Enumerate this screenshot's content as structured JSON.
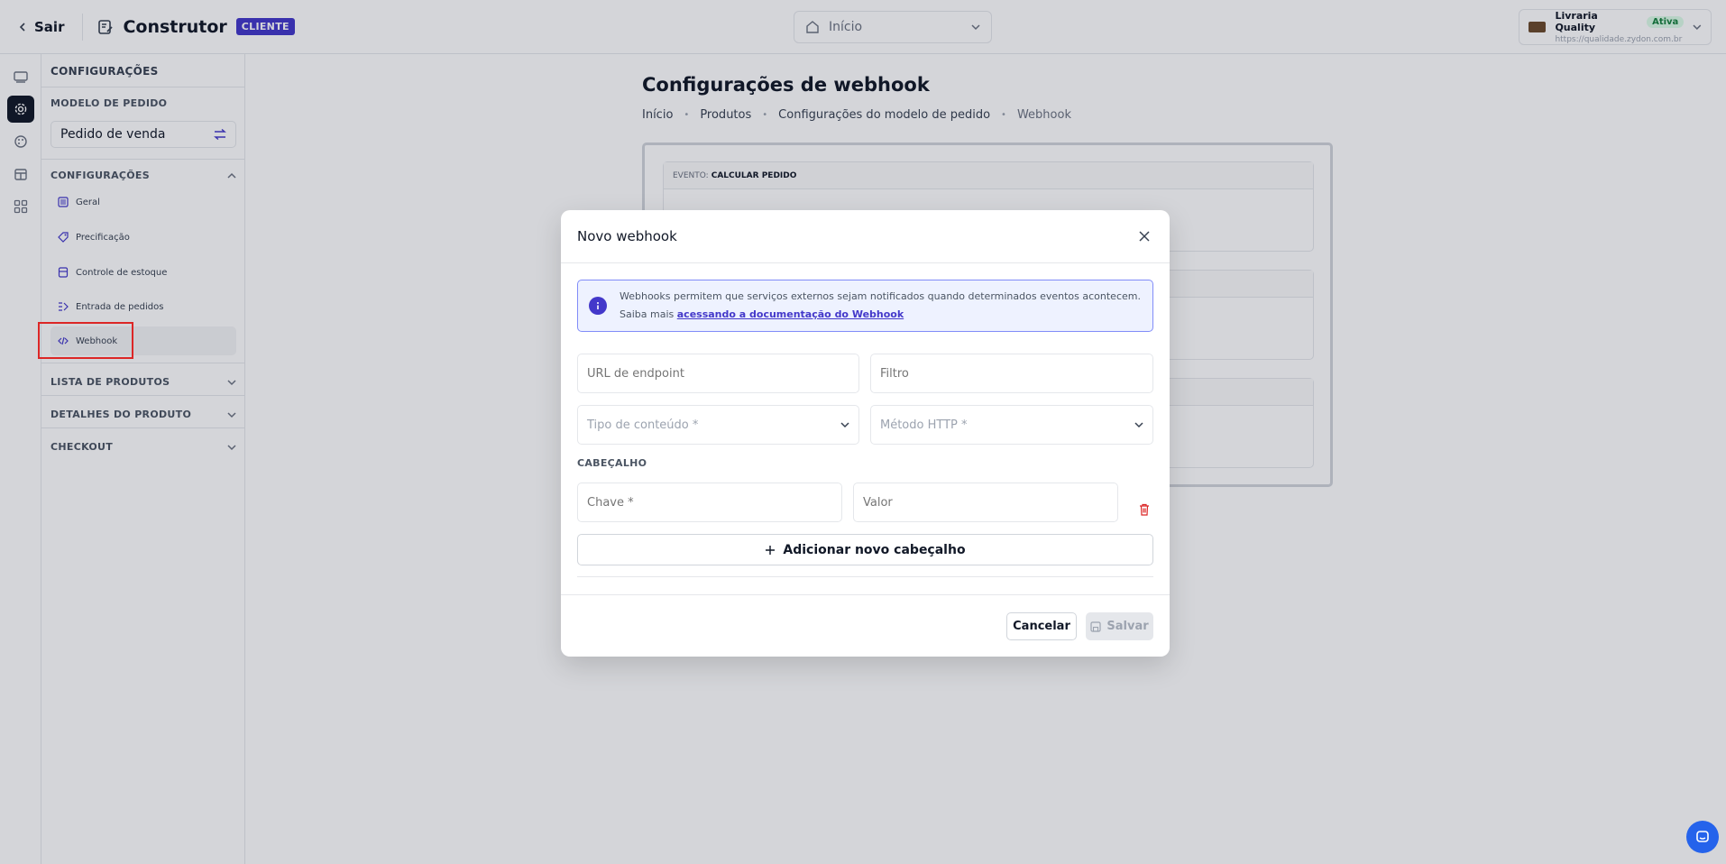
{
  "topbar": {
    "back_label": "Sair",
    "app_title": "Construtor",
    "badge": "CLIENTE",
    "page_select": "Início",
    "store_name": "Livraria Quality",
    "store_status": "Ativa",
    "store_url": "https://qualidade.zydon.com.br"
  },
  "rail": {
    "items": [
      "pages-icon",
      "gear-icon",
      "palette-icon",
      "store-icon",
      "apps-icon"
    ]
  },
  "sidebar": {
    "title": "CONFIGURAÇÕES",
    "model_label": "MODELO DE PEDIDO",
    "model_value": "Pedido de venda",
    "config_section": "CONFIGURAÇÕES",
    "items": [
      {
        "label": "Geral"
      },
      {
        "label": "Precificação"
      },
      {
        "label": "Controle de estoque"
      },
      {
        "label": "Entrada de pedidos"
      },
      {
        "label": "Webhook"
      }
    ],
    "sections": [
      "LISTA DE PRODUTOS",
      "DETALHES DO PRODUTO",
      "CHECKOUT"
    ]
  },
  "main": {
    "title": "Configurações de webhook",
    "breadcrumbs": [
      "Início",
      "Produtos",
      "Configurações do modelo de pedido",
      "Webhook"
    ],
    "event_prefix": "EVENTO:",
    "event_name": "CALCULAR PEDIDO"
  },
  "modal": {
    "title": "Novo webhook",
    "info_text": "Webhooks permitem que serviços externos sejam notificados quando determinados eventos acontecem. Saiba mais",
    "info_link": "acessando a documentação do Webhook",
    "endpoint_placeholder": "URL de endpoint",
    "filter_placeholder": "Filtro",
    "content_type_placeholder": "Tipo de conteúdo *",
    "http_method_placeholder": "Método HTTP *",
    "header_label": "CABEÇALHO",
    "key_placeholder": "Chave *",
    "value_placeholder": "Valor",
    "add_header_label": "Adicionar novo cabeçalho",
    "cancel_label": "Cancelar",
    "save_label": "Salvar"
  },
  "colors": {
    "accent": "#4338ca",
    "status_active": "#15803d",
    "danger": "#dc2626"
  }
}
